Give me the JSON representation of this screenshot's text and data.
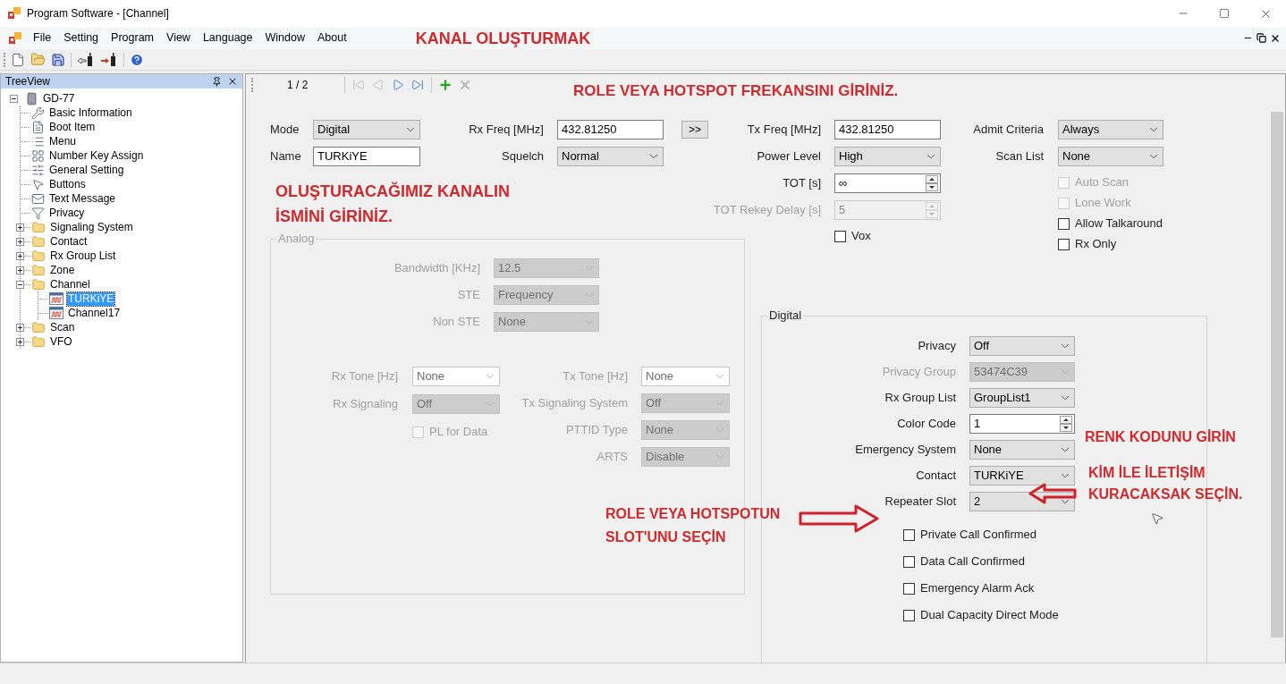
{
  "window": {
    "title": "Program Software - [Channel]"
  },
  "menu": [
    "File",
    "Setting",
    "Program",
    "View",
    "Language",
    "Window",
    "About"
  ],
  "annotations": {
    "title": "KANAL OLUŞTURMAK",
    "frequency": "ROLE VEYA HOTSPOT FREKANSINI GİRİNİZ.",
    "name": "OLUŞTURACAĞIMIZ KANALIN\nİSMİNİ GİRİNİZ.",
    "color_code": "RENK KODUNU GİRİN",
    "contact": "KİM İLE İLETİŞİM\nKURACAKSAK SEÇİN.",
    "repeater_slot": "ROLE VEYA HOTSPOTUN\nSLOT'UNU SEÇİN"
  },
  "tree": {
    "title": "TreeView",
    "items": [
      {
        "label": "GD-77",
        "kind": "device",
        "selected": false,
        "expanded": true,
        "children": [
          {
            "label": "Basic Information",
            "kind": "setting",
            "selected": false
          },
          {
            "label": "Boot Item",
            "kind": "setting",
            "selected": false
          },
          {
            "label": "Menu",
            "kind": "setting",
            "selected": false
          },
          {
            "label": "Number Key Assign",
            "kind": "setting",
            "selected": false
          },
          {
            "label": "General Setting",
            "kind": "setting",
            "selected": false
          },
          {
            "label": "Buttons",
            "kind": "setting",
            "selected": false
          },
          {
            "label": "Text Message",
            "kind": "setting",
            "selected": false
          },
          {
            "label": "Privacy",
            "kind": "setting",
            "selected": false
          },
          {
            "label": "Signaling System",
            "kind": "folder",
            "selected": false,
            "expanded": false
          },
          {
            "label": "Contact",
            "kind": "folder",
            "selected": false,
            "expanded": false
          },
          {
            "label": "Rx Group List",
            "kind": "folder",
            "selected": false,
            "expanded": false
          },
          {
            "label": "Zone",
            "kind": "folder",
            "selected": false,
            "expanded": false
          },
          {
            "label": "Channel",
            "kind": "folder",
            "selected": false,
            "expanded": true,
            "children": [
              {
                "label": "TURKiYE",
                "kind": "channel",
                "selected": true
              },
              {
                "label": "Channel17",
                "kind": "channel",
                "selected": false
              }
            ]
          },
          {
            "label": "Scan",
            "kind": "folder",
            "selected": false,
            "expanded": false
          },
          {
            "label": "VFO",
            "kind": "folder",
            "selected": false,
            "expanded": false
          }
        ]
      }
    ]
  },
  "navigator": {
    "position": "1 / 2",
    "buttons": [
      {
        "kind": "first",
        "disabled": true
      },
      {
        "kind": "previous",
        "disabled": true
      },
      {
        "kind": "next",
        "disabled": false
      },
      {
        "kind": "last",
        "disabled": false
      },
      {
        "kind": "add",
        "disabled": false
      },
      {
        "kind": "delete",
        "disabled": true
      }
    ]
  },
  "general": {
    "columns": [
      [
        {
          "label": "Mode",
          "kind": "dropdown",
          "value": "Digital",
          "disabled": false
        },
        {
          "label": "Name",
          "kind": "text",
          "value": "TURKiYE",
          "disabled": false
        }
      ],
      [
        {
          "label": "Rx Freq [MHz]",
          "kind": "text",
          "value": "432.81250",
          "button": ">>",
          "disabled": false
        },
        {
          "label": "Squelch",
          "kind": "dropdown",
          "value": "Normal",
          "disabled": false
        }
      ],
      [
        {
          "label": "Tx Freq [MHz]",
          "kind": "text",
          "value": "432.81250",
          "disabled": false
        },
        {
          "label": "Power Level",
          "kind": "dropdown",
          "value": "High",
          "disabled": false
        },
        {
          "label": "TOT [s]",
          "kind": "spin",
          "value": "∞",
          "disabled": false
        },
        {
          "label": "TOT Rekey Delay [s]",
          "kind": "spin",
          "value": "5",
          "disabled": true
        },
        {
          "label": "Vox",
          "kind": "checkbox",
          "checked": false,
          "disabled": false
        }
      ],
      [
        {
          "label": "Admit Criteria",
          "kind": "dropdown",
          "value": "Always",
          "disabled": false
        },
        {
          "label": "Scan List",
          "kind": "dropdown",
          "value": "None",
          "disabled": false
        },
        {
          "label": "Auto Scan",
          "kind": "checkbox",
          "checked": false,
          "disabled": true
        },
        {
          "label": "Lone Work",
          "kind": "checkbox",
          "checked": false,
          "disabled": true
        },
        {
          "label": "Allow Talkaround",
          "kind": "checkbox",
          "checked": false,
          "disabled": false
        },
        {
          "label": "Rx Only",
          "kind": "checkbox",
          "checked": false,
          "disabled": false
        }
      ]
    ]
  },
  "analog": {
    "title": "Analog",
    "upper": [
      {
        "label": "Bandwidth [KHz]",
        "kind": "dropdown",
        "value": "12.5",
        "disabled": true
      },
      {
        "label": "STE",
        "kind": "dropdown",
        "value": "Frequency",
        "disabled": true
      },
      {
        "label": "Non STE",
        "kind": "dropdown",
        "value": "None",
        "disabled": true
      }
    ],
    "left": [
      {
        "label": "Rx Tone [Hz]",
        "kind": "combo",
        "value": "None",
        "disabled": true
      },
      {
        "label": "Rx Signaling",
        "kind": "dropdown",
        "value": "Off",
        "disabled": true
      },
      {
        "label": "PL for Data",
        "kind": "checkbox",
        "checked": false,
        "disabled": true
      }
    ],
    "right": [
      {
        "label": "Tx Tone [Hz]",
        "kind": "combo",
        "value": "None",
        "disabled": true
      },
      {
        "label": "Tx Signaling System",
        "kind": "dropdown",
        "value": "Off",
        "disabled": true
      },
      {
        "label": "PTTID Type",
        "kind": "dropdown",
        "value": "None",
        "disabled": true
      },
      {
        "label": "ARTS",
        "kind": "dropdown",
        "value": "Disable",
        "disabled": true
      }
    ]
  },
  "digital": {
    "title": "Digital",
    "fields": [
      {
        "label": "Privacy",
        "kind": "dropdown",
        "value": "Off",
        "disabled": false
      },
      {
        "label": "Privacy Group",
        "kind": "dropdown",
        "value": "53474C39",
        "disabled": true
      },
      {
        "label": "Rx Group List",
        "kind": "dropdown",
        "value": "GroupList1",
        "disabled": false
      },
      {
        "label": "Color Code",
        "kind": "spin",
        "value": "1",
        "disabled": false
      },
      {
        "label": "Emergency System",
        "kind": "dropdown",
        "value": "None",
        "disabled": false
      },
      {
        "label": "Contact",
        "kind": "dropdown",
        "value": "TURKiYE",
        "disabled": false
      },
      {
        "label": "Repeater Slot",
        "kind": "dropdown",
        "value": "2",
        "disabled": false
      },
      {
        "label": "Private Call Confirmed",
        "kind": "checkbox",
        "checked": false,
        "disabled": false
      },
      {
        "label": "Data Call Confirmed",
        "kind": "checkbox",
        "checked": false,
        "disabled": false
      },
      {
        "label": "Emergency Alarm Ack",
        "kind": "checkbox",
        "checked": false,
        "disabled": false
      },
      {
        "label": "Dual Capacity Direct Mode",
        "kind": "checkbox",
        "checked": false,
        "disabled": false
      }
    ]
  }
}
